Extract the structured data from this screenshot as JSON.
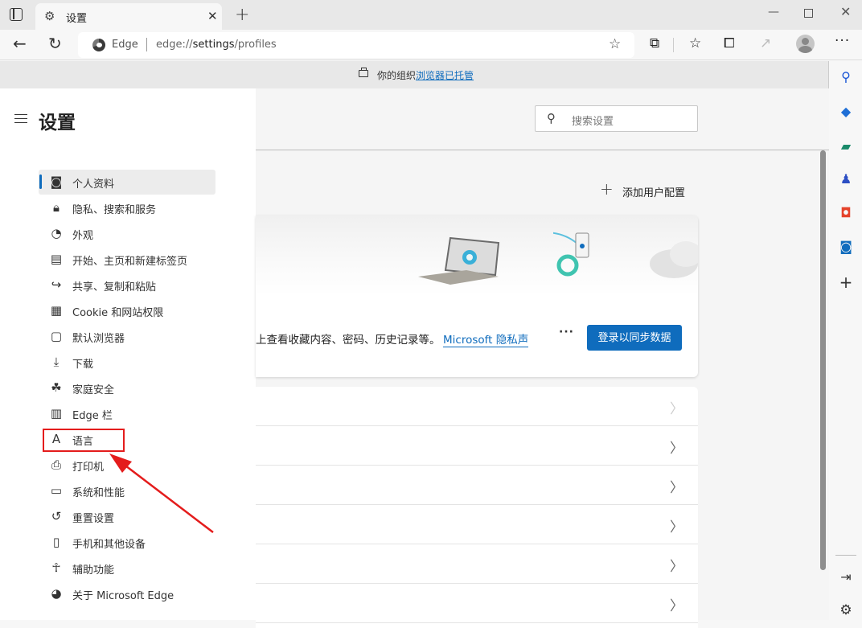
{
  "browser": {
    "tab": {
      "title": "设置",
      "icon": "gear-icon"
    },
    "new_tab_symbol": "+",
    "window_controls": {
      "minimize": "—",
      "maximize": "",
      "close": "✕"
    },
    "address_bar": {
      "site_label": "Edge",
      "url_prefix": "edge://",
      "url_host": "settings",
      "url_path": "/profiles"
    },
    "toolbar_icons": [
      "extensions-icon",
      "favorites-icon",
      "collections-icon",
      "share-icon",
      "profile-avatar",
      "more-icon"
    ]
  },
  "banner": {
    "text": "你的组织",
    "link": "浏览器已托管",
    "icon": "briefcase-icon"
  },
  "settings_nav": {
    "title": "设置",
    "items": [
      {
        "label": "个人资料",
        "icon": "profile-icon",
        "active": true
      },
      {
        "label": "隐私、搜索和服务",
        "icon": "lock-icon"
      },
      {
        "label": "外观",
        "icon": "palette-icon"
      },
      {
        "label": "开始、主页和新建标签页",
        "icon": "home-tab-icon"
      },
      {
        "label": "共享、复制和粘贴",
        "icon": "share-icon"
      },
      {
        "label": "Cookie 和网站权限",
        "icon": "cookie-permissions-icon"
      },
      {
        "label": "默认浏览器",
        "icon": "default-browser-icon"
      },
      {
        "label": "下载",
        "icon": "download-icon"
      },
      {
        "label": "家庭安全",
        "icon": "family-icon"
      },
      {
        "label": "Edge 栏",
        "icon": "edge-bar-icon"
      },
      {
        "label": "语言",
        "icon": "language-icon",
        "highlighted": true
      },
      {
        "label": "打印机",
        "icon": "printer-icon"
      },
      {
        "label": "系统和性能",
        "icon": "laptop-icon"
      },
      {
        "label": "重置设置",
        "icon": "reset-icon"
      },
      {
        "label": "手机和其他设备",
        "icon": "phone-icon"
      },
      {
        "label": "辅助功能",
        "icon": "accessibility-icon"
      },
      {
        "label": "关于 Microsoft Edge",
        "icon": "edge-logo-icon"
      }
    ]
  },
  "main": {
    "search_placeholder": "搜索设置",
    "add_profile_label": "添加用户配置",
    "sync_card": {
      "description": "上查看收藏内容、密码、历史记录等。",
      "privacy_link": "Microsoft 隐私声",
      "more": "···",
      "signin_button": "登录以同步数据"
    },
    "list_rows": 6
  },
  "right_sidebar": {
    "items": [
      "search-icon",
      "shopping-tag-icon",
      "tools-icon",
      "games-icon",
      "office-icon",
      "outlook-icon",
      "add-icon"
    ],
    "bottom": [
      "hide-sidebar-icon",
      "settings-icon"
    ]
  },
  "annotation": {
    "color": "#e41c1c",
    "target": "语言"
  },
  "colors": {
    "accent": "#0f6cbd",
    "annotation": "#e41c1c"
  }
}
